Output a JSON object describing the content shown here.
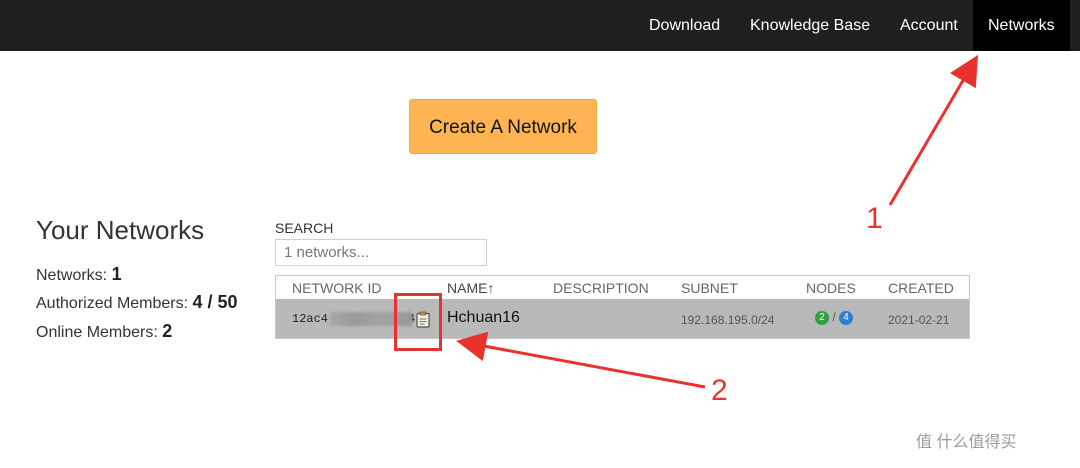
{
  "nav": {
    "items": [
      {
        "label": "Download"
      },
      {
        "label": "Knowledge Base"
      },
      {
        "label": "Account"
      },
      {
        "label": "Networks"
      }
    ],
    "active": "Networks"
  },
  "create_button": {
    "label": "Create A Network"
  },
  "summary": {
    "title": "Your Networks",
    "networks_label": "Networks:",
    "networks_value": "1",
    "authorized_label": "Authorized Members:",
    "authorized_value": "4 / 50",
    "online_label": "Online Members:",
    "online_value": "2"
  },
  "search": {
    "label": "SEARCH",
    "placeholder": "1 networks..."
  },
  "table": {
    "headers": [
      "NETWORK ID",
      "NAME↑",
      "DESCRIPTION",
      "SUBNET",
      "NODES",
      "CREATED"
    ],
    "rows": [
      {
        "network_id_prefix": "12ac4",
        "network_id_suffix": "4",
        "name": "Hchuan16",
        "description": "",
        "subnet": "192.168.195.0/24",
        "nodes_online": "2",
        "nodes_sep": "/",
        "nodes_total": "4",
        "created": "2021-02-21"
      }
    ]
  },
  "annotations": {
    "label_1": "1",
    "label_2": "2",
    "color": "#e8322e"
  },
  "watermark": {
    "text": "值 什么值得买"
  },
  "colors": {
    "topbar": "#1f1f1f",
    "create_button": "#ffb454",
    "row_bg": "#b9b9b9",
    "badge_online": "#2ea043",
    "badge_total": "#2f7fd1"
  },
  "icons": [
    "clipboard-icon",
    "sort-up-arrow"
  ]
}
